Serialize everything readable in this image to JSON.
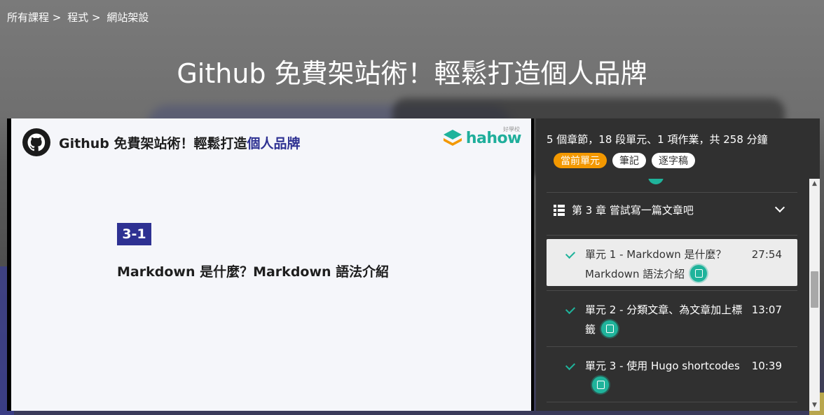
{
  "breadcrumb": [
    "所有課程",
    "程式",
    "網站架設"
  ],
  "breadcrumb_sep": ">",
  "page_title": "Github 免費架站術！輕鬆打造個人品牌",
  "slide": {
    "title_prefix": "Github 免費架站術！輕鬆打造",
    "title_highlight": "個人品牌",
    "brand": "hahow",
    "brand_sub": "好學校",
    "lesson_number": "3-1",
    "lesson_title": "Markdown 是什麼？Markdown 語法介紹"
  },
  "sidebar": {
    "summary": "5 個章節，18 段單元、1 項作業，共 258 分鐘",
    "tabs": [
      {
        "label": "當前單元",
        "active": true
      },
      {
        "label": "筆記",
        "active": false
      },
      {
        "label": "逐字稿",
        "active": false
      }
    ],
    "chapter": {
      "title": "第 3 章 嘗試寫一篇文章吧",
      "icon": "list-icon",
      "expanded": true
    },
    "units": [
      {
        "title": "單元 1 - Markdown 是什麼？ Markdown 語法介紹",
        "time": "27:54",
        "completed": true,
        "current": true
      },
      {
        "title": "單元 2 - 分類文章、為文章加上標籤",
        "time": "13:07",
        "completed": true,
        "current": false
      },
      {
        "title": "單元 3 - 使用 Hugo shortcodes",
        "time": "10:39",
        "completed": true,
        "current": false
      }
    ]
  },
  "colors": {
    "accent_orange": "#f39800",
    "teal": "#1fb39b",
    "slide_blue": "#2e3192",
    "sidebar_bg": "#303030"
  }
}
